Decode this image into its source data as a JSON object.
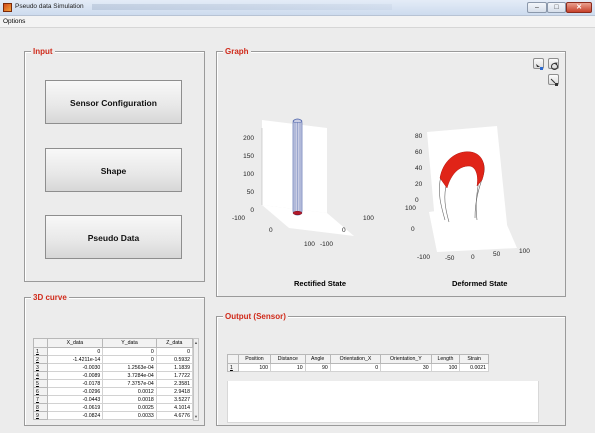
{
  "window": {
    "title": "Pseudo data Simulation",
    "min": "–",
    "max": "□",
    "close": "✕"
  },
  "menu": {
    "options": "Options"
  },
  "input_panel": {
    "title": "Input",
    "buttons": {
      "sensor": "Sensor Configuration",
      "shape": "Shape",
      "pseudo": "Pseudo Data"
    }
  },
  "curve_panel": {
    "title": "3D curve",
    "columns": [
      "",
      "X_data",
      "Y_data",
      "Z_data"
    ],
    "rows": [
      [
        "1",
        "0",
        "0",
        "0"
      ],
      [
        "2",
        "-1.4211e-14",
        "0",
        "0.5932"
      ],
      [
        "3",
        "-0.0030",
        "1.2563e-04",
        "1.1839"
      ],
      [
        "4",
        "-0.0089",
        "3.7284e-04",
        "1.7722"
      ],
      [
        "5",
        "-0.0178",
        "7.3757e-04",
        "2.3581"
      ],
      [
        "6",
        "-0.0296",
        "0.0012",
        "2.9418"
      ],
      [
        "7",
        "-0.0443",
        "0.0018",
        "3.5227"
      ],
      [
        "8",
        "-0.0619",
        "0.0025",
        "4.1014"
      ],
      [
        "9",
        "-0.0824",
        "0.0033",
        "4.6776"
      ]
    ]
  },
  "graph_panel": {
    "title": "Graph",
    "plot1": {
      "caption": "Rectified State",
      "z_ticks": [
        "0",
        "50",
        "100",
        "150",
        "200"
      ],
      "x_ticks": [
        "-100",
        "0",
        "100"
      ],
      "y_ticks": [
        "-100",
        "0",
        "100"
      ]
    },
    "plot2": {
      "caption": "Deformed State",
      "z_ticks": [
        "0",
        "20",
        "40",
        "60",
        "80"
      ],
      "left_ticks": [
        "100",
        "0"
      ],
      "bottom_ticks": [
        "-100",
        "-50",
        "0",
        "50",
        "100"
      ]
    },
    "tools": [
      "zoom-icon",
      "rotate-icon",
      "data-cursor-icon"
    ],
    "colors": {
      "tube": "#5a6fb0",
      "deformed_band": "#e02418",
      "title": "#d02a1a"
    }
  },
  "output_panel": {
    "title": "Output (Sensor)",
    "columns": [
      "",
      "Position",
      "Distance",
      "Angle",
      "Orientation_X",
      "Orientation_Y",
      "Length",
      "Strain"
    ],
    "rows": [
      [
        "1",
        "100",
        "10",
        "90",
        "0",
        "30",
        "100",
        "0.0021"
      ]
    ]
  }
}
